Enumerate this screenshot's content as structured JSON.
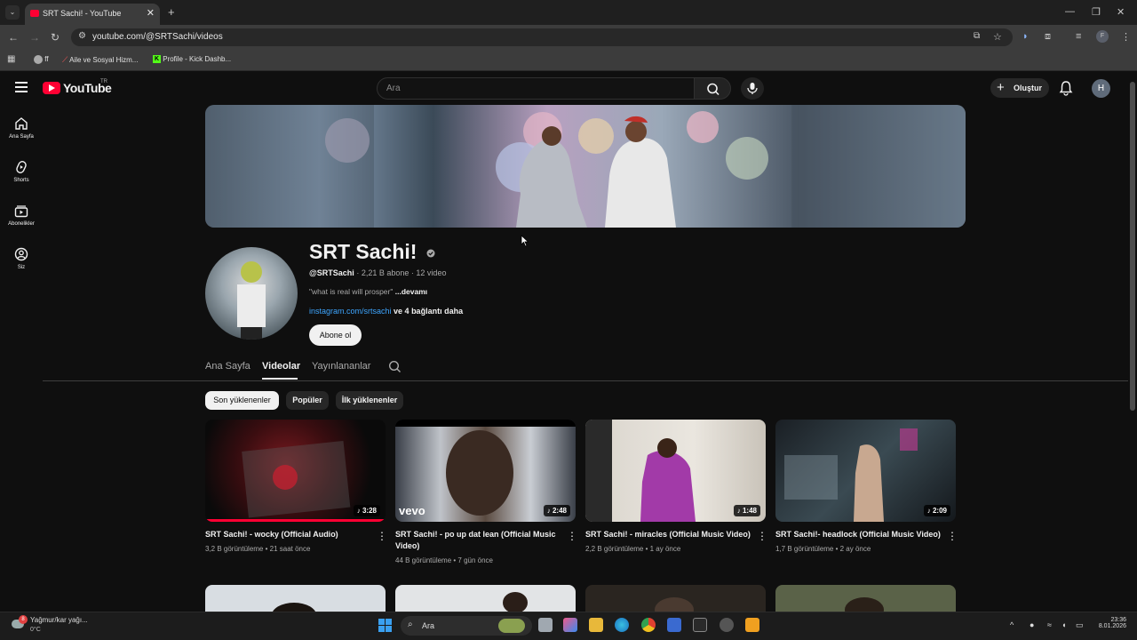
{
  "browser": {
    "tab_title": "SRT Sachi! - YouTube",
    "new_tab": "+",
    "url": "youtube.com/@SRTSachi/videos",
    "bookmarks": [
      {
        "label": "ff"
      },
      {
        "label": "Aile ve Sosyal Hizm..."
      },
      {
        "label": "Profile - Kick Dashb..."
      }
    ]
  },
  "youtube": {
    "logo_text": "YouTube",
    "logo_region": "TR",
    "search_placeholder": "Ara",
    "create_label": "Oluştur",
    "avatar_letter": "H",
    "sidebar": [
      {
        "label": "Ana Sayfa",
        "icon": "home-icon"
      },
      {
        "label": "Shorts",
        "icon": "shorts-icon"
      },
      {
        "label": "Abonelikler",
        "icon": "subscriptions-icon"
      },
      {
        "label": "Siz",
        "icon": "you-icon"
      }
    ]
  },
  "channel": {
    "name": "SRT Sachi!",
    "handle": "@SRTSachi",
    "subscribers": "2,21 B abone",
    "video_count": "12 video",
    "description": "\"what is real will prosper\"",
    "more": "...devamı",
    "link": "instagram.com/srtsachi",
    "more_links": "ve 4 bağlantı daha",
    "subscribe_label": "Abone ol",
    "tabs": [
      "Ana Sayfa",
      "Videolar",
      "Yayınlananlar"
    ],
    "active_tab": "Videolar"
  },
  "filters": {
    "chips": [
      "Son yüklenenler",
      "Popüler",
      "İlk yüklenenler"
    ],
    "active": "Son yüklenenler"
  },
  "videos": [
    {
      "title": "SRT Sachi! - wocky (Official Audio)",
      "duration": "3:28",
      "views": "3,2 B görüntüleme",
      "age": "21 saat önce",
      "watched_fraction": 1.0
    },
    {
      "title": "SRT Sachi! - po up dat lean (Official Music Video)",
      "duration": "2:48",
      "views": "44 B görüntüleme",
      "age": "7 gün önce",
      "watched_fraction": 0
    },
    {
      "title": "SRT Sachi! - miracles (Official Music Video)",
      "duration": "1:48",
      "views": "2,2 B görüntüleme",
      "age": "1 ay önce",
      "watched_fraction": 0
    },
    {
      "title": "SRT Sachi!- headlock (Official Music Video)",
      "duration": "2:09",
      "views": "1,7 B görüntüleme",
      "age": "2 ay önce",
      "watched_fraction": 0
    }
  ],
  "taskbar": {
    "weather_text": "Yağmur/kar yağı...",
    "temperature": "0°C",
    "weather_badge": "8",
    "search_label": "Ara",
    "time": "23:36",
    "date": "8.01.2026"
  },
  "colors": {
    "background": "#0f0f0f",
    "accent_red": "#ff0033",
    "link_blue": "#3ea6ff"
  }
}
